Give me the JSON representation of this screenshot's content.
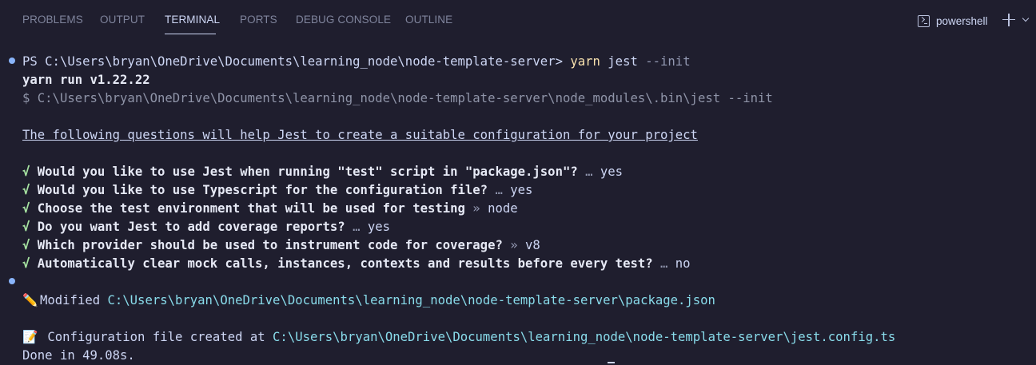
{
  "tabs": [
    {
      "label": "PROBLEMS"
    },
    {
      "label": "OUTPUT"
    },
    {
      "label": "TERMINAL",
      "active": true
    },
    {
      "label": "PORTS"
    },
    {
      "label": "DEBUG CONSOLE"
    },
    {
      "label": "OUTLINE"
    }
  ],
  "shell": {
    "label": "powershell",
    "icon": "terminal-icon"
  },
  "terminal": {
    "prompt": "PS C:\\Users\\bryan\\OneDrive\\Documents\\learning_node\\node-template-server> ",
    "cmd_yarn": "yarn",
    "cmd_jest": " jest",
    "cmd_flag": " --init",
    "yarn_version": "yarn run v1.22.22",
    "exec_line": "$ C:\\Users\\bryan\\OneDrive\\Documents\\learning_node\\node-template-server\\node_modules\\.bin\\jest --init",
    "intro": "The following questions will help Jest to create a suitable configuration for your project",
    "questions": [
      {
        "check": "√",
        "question": "Would you like to use Jest when running \"test\" script in \"package.json\"?",
        "sep": " … ",
        "answer": "yes"
      },
      {
        "check": "√",
        "question": "Would you like to use Typescript for the configuration file?",
        "sep": " … ",
        "answer": "yes"
      },
      {
        "check": "√",
        "question": "Choose the test environment that will be used for testing",
        "sep": " » ",
        "answer": "node"
      },
      {
        "check": "√",
        "question": "Do you want Jest to add coverage reports?",
        "sep": " … ",
        "answer": "yes"
      },
      {
        "check": "√",
        "question": "Which provider should be used to instrument code for coverage?",
        "sep": " » ",
        "answer": "v8"
      },
      {
        "check": "√",
        "question": "Automatically clear mock calls, instances, contexts and results before every test?",
        "sep": " … ",
        "answer": "no"
      }
    ],
    "modified_emoji": "✏️",
    "modified_label": "Modified ",
    "modified_path": "C:\\Users\\bryan\\OneDrive\\Documents\\learning_node\\node-template-server\\package.json",
    "config_emoji": "📝",
    "config_label": " Configuration file created at ",
    "config_path": "C:\\Users\\bryan\\OneDrive\\Documents\\learning_node\\node-template-server\\jest.config.ts",
    "done": "Done in 49.08s."
  }
}
